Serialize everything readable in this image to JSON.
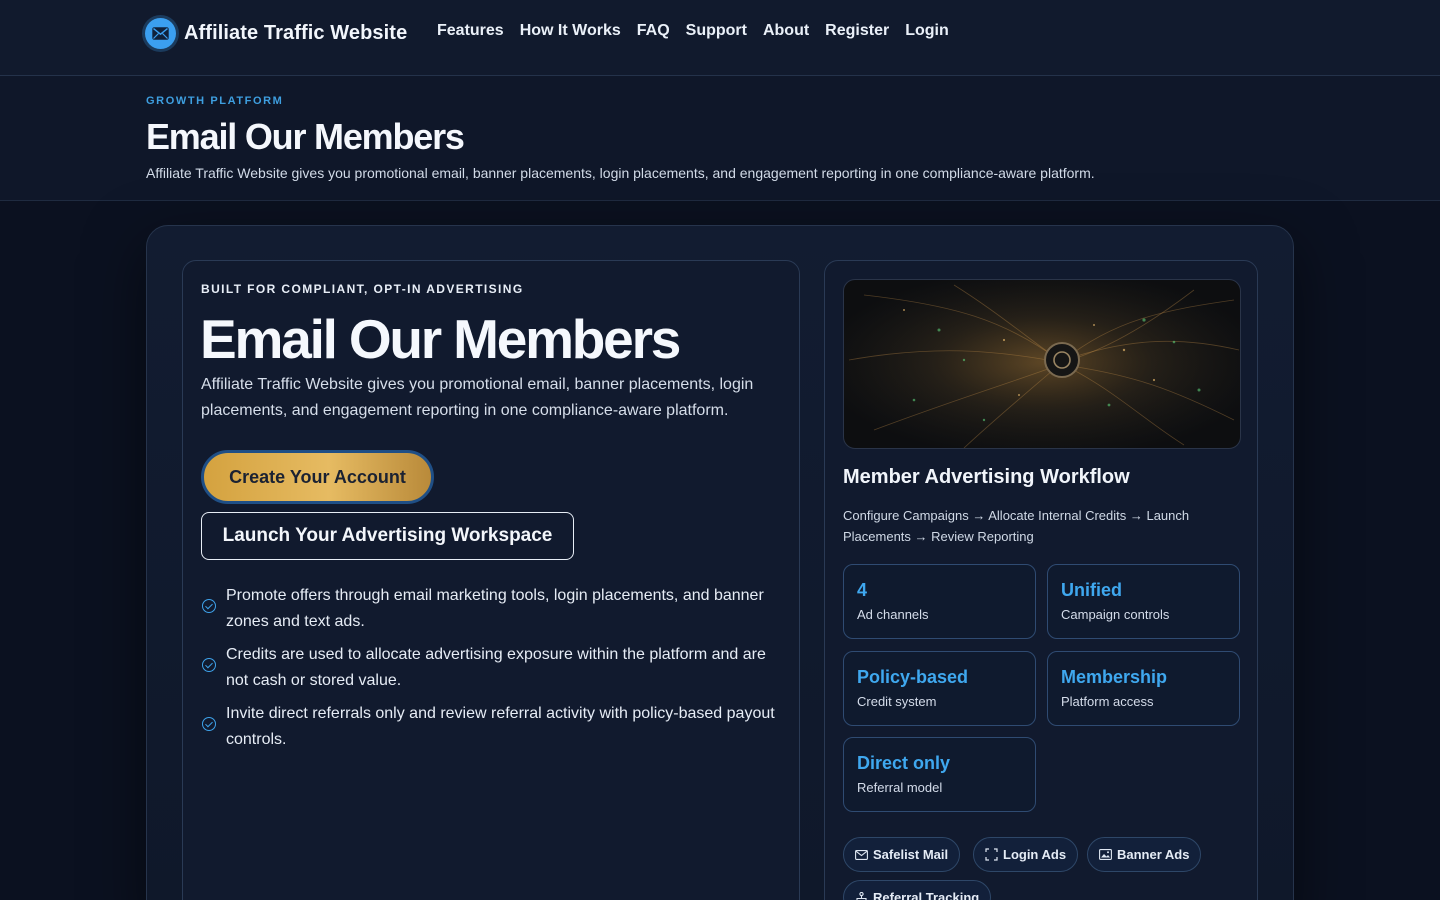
{
  "brand": {
    "name": "Affiliate Traffic Website",
    "logo_icon": "envelope-icon"
  },
  "nav": [
    "Features",
    "How It Works",
    "FAQ",
    "Support",
    "About",
    "Register",
    "Login"
  ],
  "subheader": {
    "eyebrow": "GROWTH PLATFORM",
    "title": "Email Our Members",
    "description": "Affiliate Traffic Website gives you promotional email, banner placements, login placements, and engagement reporting in one compliance-aware platform."
  },
  "hero": {
    "eyebrow": "BUILT FOR COMPLIANT, OPT-IN ADVERTISING",
    "title": "Email Our Members",
    "description": "Affiliate Traffic Website gives you promotional email, banner placements, login placements, and engagement reporting in one compliance-aware platform.",
    "primary_cta": "Create Your Account",
    "secondary_cta": "Launch Your Advertising Workspace",
    "features": [
      "Promote offers through email marketing tools, login placements, and banner zones and text ads.",
      "Credits are used to allocate advertising exposure within the platform and are not cash or stored value.",
      "Invite direct referrals only and review referral activity with policy-based payout controls."
    ]
  },
  "workflow": {
    "title": "Member Advertising Workflow",
    "steps": "Configure Campaigns → Allocate Internal Credits → Launch Placements → Review Reporting",
    "stats": [
      {
        "value": "4",
        "label": "Ad channels"
      },
      {
        "value": "Unified",
        "label": "Campaign controls"
      },
      {
        "value": "Policy-based",
        "label": "Credit system"
      },
      {
        "value": "Membership",
        "label": "Platform access"
      },
      {
        "value": "Direct only",
        "label": "Referral model"
      }
    ],
    "chips": [
      {
        "label": "Safelist Mail",
        "icon": "mail-icon"
      },
      {
        "label": "Login Ads",
        "icon": "expand-icon"
      },
      {
        "label": "Banner Ads",
        "icon": "image-icon"
      },
      {
        "label": "Referral Tracking",
        "icon": "network-icon"
      }
    ]
  },
  "colors": {
    "accent": "#3fa8ef",
    "gold": "#d4a23f",
    "background": "#0b1120"
  }
}
